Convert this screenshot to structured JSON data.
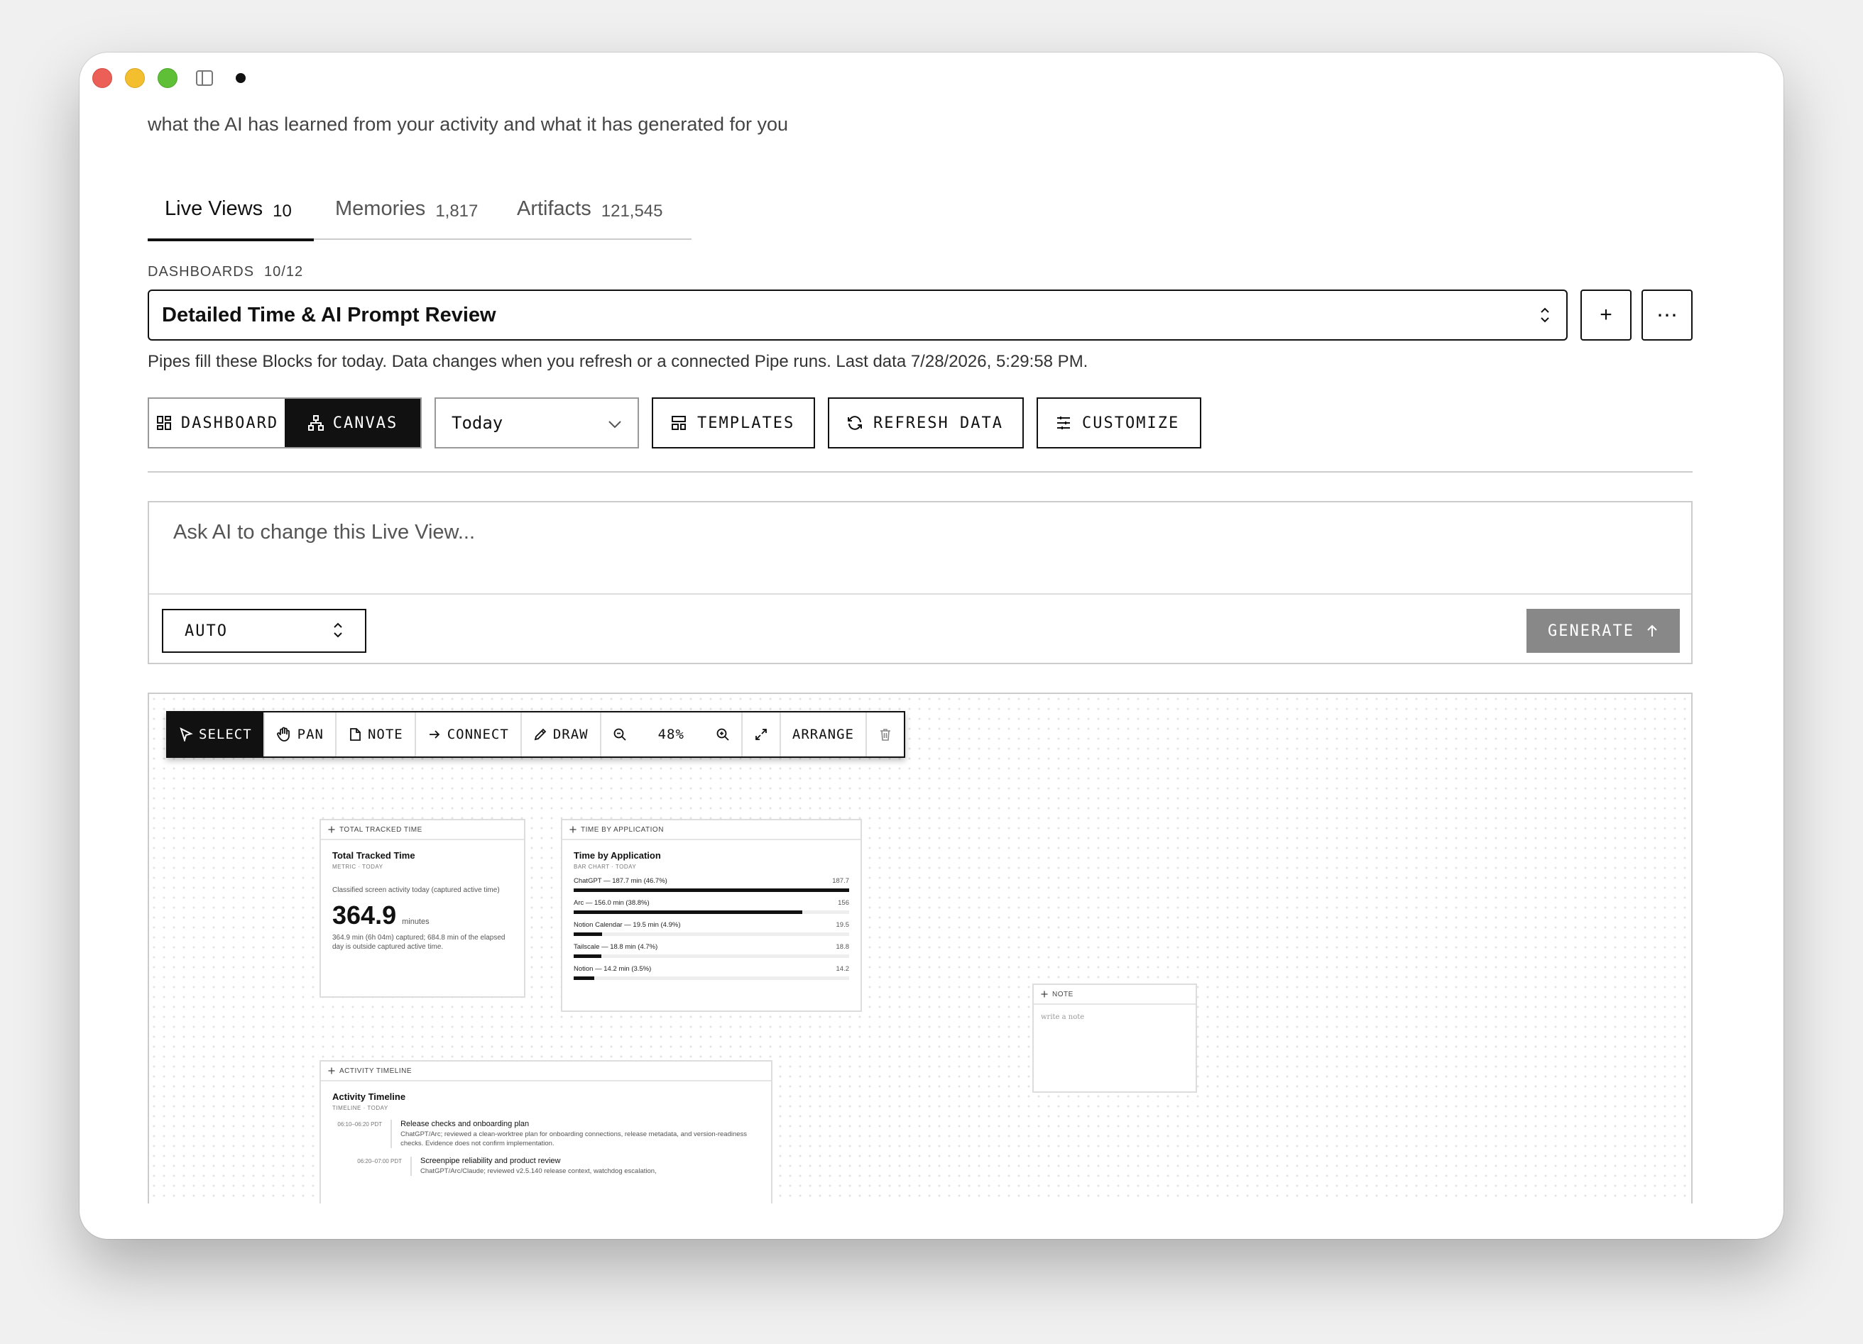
{
  "header": {
    "subtitle": "what the AI has learned from your activity and what it has generated for you"
  },
  "tabs": [
    {
      "label": "Live Views",
      "count": "10"
    },
    {
      "label": "Memories",
      "count": "1,817"
    },
    {
      "label": "Artifacts",
      "count": "121,545"
    }
  ],
  "dashboards": {
    "label": "DASHBOARDS",
    "count": "10/12",
    "selected": "Detailed Time & AI Prompt Review",
    "add_label": "+",
    "more_label": "⋯",
    "info": "Pipes fill these Blocks for today. Data changes when you refresh or a connected Pipe runs. Last data 7/28/2026, 5:29:58 PM."
  },
  "view_toggle": {
    "dashboard_label": "DASHBOARD",
    "canvas_label": "CANVAS",
    "active": "canvas"
  },
  "date_select": {
    "value": "Today"
  },
  "actions": {
    "templates_label": "TEMPLATES",
    "refresh_label": "REFRESH DATA",
    "customize_label": "CUSTOMIZE"
  },
  "ai_prompt": {
    "placeholder": "Ask AI to change this Live View...",
    "mode": "AUTO",
    "generate_label": "GENERATE"
  },
  "canvas_toolbar": {
    "select_label": "SELECT",
    "pan_label": "PAN",
    "note_label": "NOTE",
    "connect_label": "CONNECT",
    "draw_label": "DRAW",
    "zoom": "48%",
    "arrange_label": "ARRANGE"
  },
  "blocks": {
    "total_time": {
      "header": "TOTAL TRACKED TIME",
      "title": "Total Tracked Time",
      "subtitle": "METRIC · TODAY",
      "description": "Classified screen activity today (captured active time)",
      "value": "364.9",
      "unit": "minutes",
      "note": "364.9 min (6h 04m) captured; 684.8 min of the elapsed day is outside captured active time."
    },
    "time_by_app": {
      "header": "TIME BY APPLICATION",
      "title": "Time by Application",
      "subtitle": "BAR CHART · TODAY",
      "bars": [
        {
          "label": "ChatGPT — 187.7 min (46.7%)",
          "value": "187.7",
          "fraction": 1.0
        },
        {
          "label": "Arc — 156.0 min (38.8%)",
          "value": "156",
          "fraction": 0.831
        },
        {
          "label": "Notion Calendar — 19.5 min (4.9%)",
          "value": "19.5",
          "fraction": 0.104
        },
        {
          "label": "Tailscale — 18.8 min (4.7%)",
          "value": "18.8",
          "fraction": 0.1
        },
        {
          "label": "Notion — 14.2 min (3.5%)",
          "value": "14.2",
          "fraction": 0.076
        }
      ]
    },
    "note": {
      "header": "NOTE",
      "placeholder": "write a note"
    },
    "timeline": {
      "header": "ACTIVITY TIMELINE",
      "title": "Activity Timeline",
      "subtitle": "TIMELINE · TODAY",
      "entries": [
        {
          "time": "06:10–06:20 PDT",
          "title": "Release checks and onboarding plan",
          "desc": "ChatGPT/Arc; reviewed a clean-worktree plan for onboarding connections, release metadata, and version-readiness checks. Evidence does not confirm implementation."
        },
        {
          "time": "06:20–07:00 PDT",
          "title": "Screenpipe reliability and product review",
          "desc": "ChatGPT/Arc/Claude; reviewed v2.5.140 release context, watchdog escalation,"
        }
      ]
    }
  }
}
